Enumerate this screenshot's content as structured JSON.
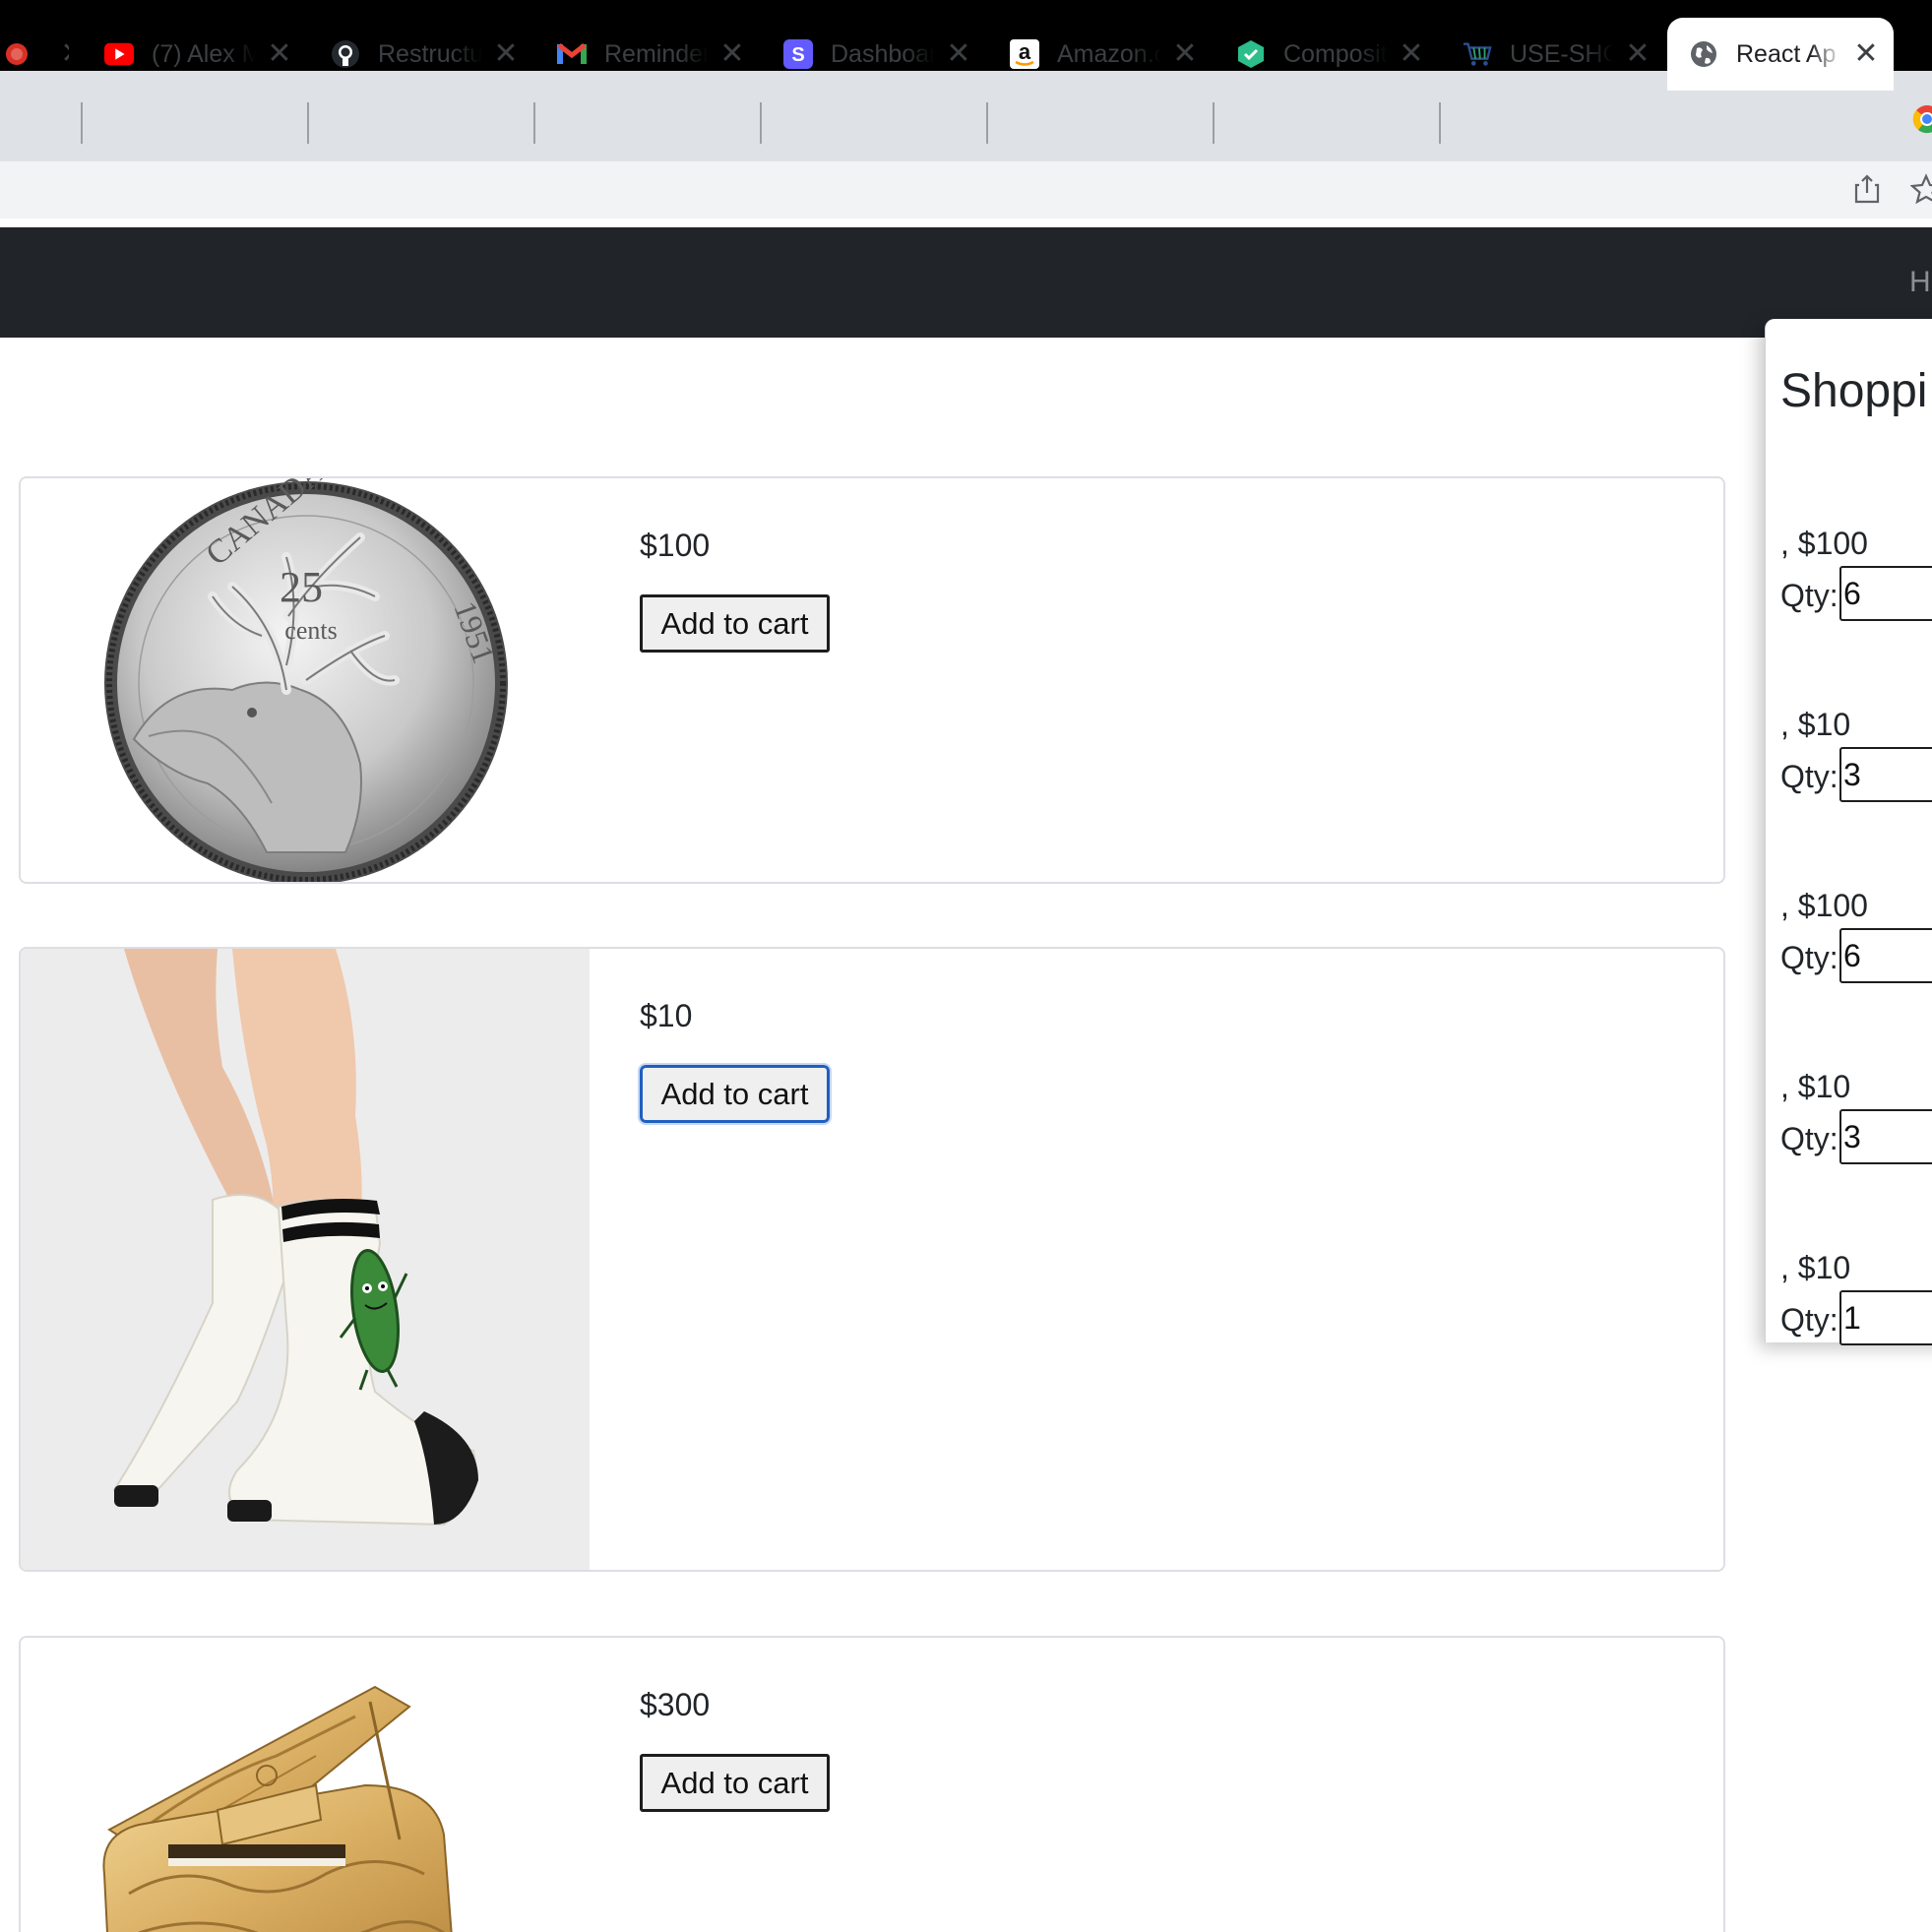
{
  "browser": {
    "tabs": [
      {
        "title": "",
        "icon": "record-icon",
        "active": false
      },
      {
        "title": "(7) Alex M",
        "icon": "youtube-icon",
        "active": false
      },
      {
        "title": "Restructure",
        "icon": "github-icon",
        "active": false
      },
      {
        "title": "Reminder",
        "icon": "gmail-icon",
        "active": false
      },
      {
        "title": "Dashboard",
        "icon": "stripe-icon",
        "active": false
      },
      {
        "title": "Amazon.c",
        "icon": "amazon-icon",
        "active": false
      },
      {
        "title": "Composit",
        "icon": "shield-icon",
        "active": false
      },
      {
        "title": "USE-SHO",
        "icon": "cart-icon",
        "active": false
      },
      {
        "title": "React Ap",
        "icon": "globe-icon",
        "active": true
      }
    ],
    "close_glyph": "✕"
  },
  "navbar": {
    "link_partial": "H"
  },
  "products": [
    {
      "price": "$100",
      "button": "Add to cart",
      "image": "canada-25-cent-coin-image",
      "focused": false
    },
    {
      "price": "$10",
      "button": "Add to cart",
      "image": "pickle-socks-image",
      "focused": true
    },
    {
      "price": "$300",
      "button": "Add to cart",
      "image": "golden-grand-piano-image",
      "focused": false
    }
  ],
  "cart": {
    "title": "Shoppi",
    "qty_label": "Qty:",
    "items": [
      {
        "line": ", $100",
        "qty": "6"
      },
      {
        "line": ", $10",
        "qty": "3"
      },
      {
        "line": ", $100",
        "qty": "6"
      },
      {
        "line": ", $10",
        "qty": "3"
      },
      {
        "line": ", $10",
        "qty": "1"
      }
    ]
  },
  "colors": {
    "navbar": "#212529",
    "tab_strip": "#dee1e6",
    "focus_ring": "#1f5fbf"
  }
}
